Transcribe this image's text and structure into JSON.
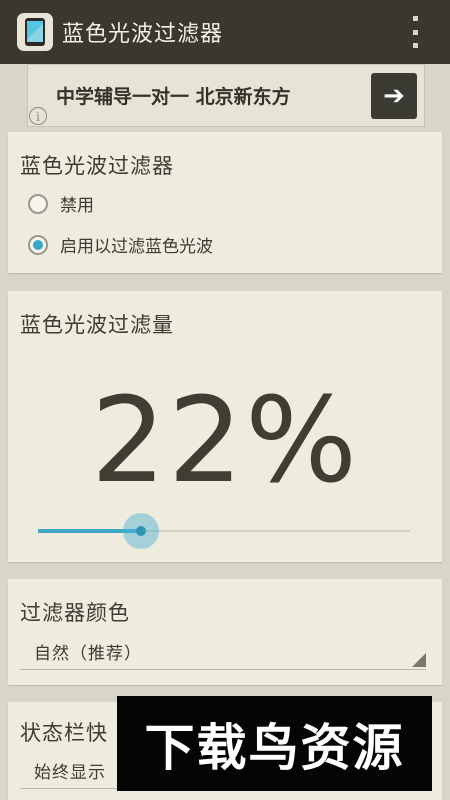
{
  "app": {
    "title": "蓝色光波过滤器",
    "icon": "app-phone-icon",
    "menu_icon": "overflow-menu-icon"
  },
  "ad": {
    "text": "中学辅导一对一 北京新东方",
    "arrow": "➔",
    "info": "i"
  },
  "filter_card": {
    "title": "蓝色光波过滤器",
    "options": [
      {
        "label": "禁用",
        "checked": false
      },
      {
        "label": "启用以过滤蓝色光波",
        "checked": true
      }
    ]
  },
  "amount_card": {
    "title": "蓝色光波过滤量",
    "value_text": "22%",
    "value": 22
  },
  "color_card": {
    "title": "过滤器颜色",
    "selected": "自然（推荐）"
  },
  "statusbar_card": {
    "title": "状态栏快",
    "selected": "始终显示"
  },
  "watermark": {
    "text": "下载鸟资源"
  },
  "colors": {
    "action_bar": "#3a382e",
    "accent": "#39a9c9",
    "background": "#d9d6c9",
    "card": "#eeebdf"
  }
}
